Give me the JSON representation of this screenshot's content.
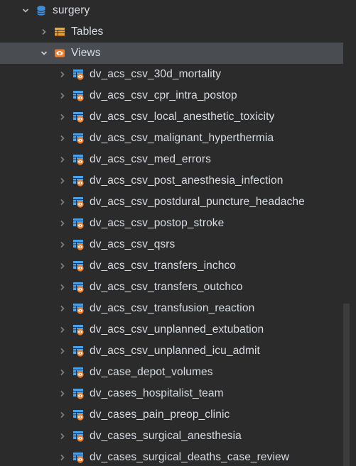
{
  "tree": {
    "database": {
      "label": "surgery",
      "icon": "database-icon",
      "expanded": true
    },
    "tables": {
      "label": "Tables",
      "icon": "table-icon",
      "expanded": false
    },
    "views": {
      "label": "Views",
      "icon": "views-folder-icon",
      "expanded": true
    },
    "view_items": [
      "dv_acs_csv_30d_mortality",
      "dv_acs_csv_cpr_intra_postop",
      "dv_acs_csv_local_anesthetic_toxicity",
      "dv_acs_csv_malignant_hyperthermia",
      "dv_acs_csv_med_errors",
      "dv_acs_csv_post_anesthesia_infection",
      "dv_acs_csv_postdural_puncture_headache",
      "dv_acs_csv_postop_stroke",
      "dv_acs_csv_qsrs",
      "dv_acs_csv_transfers_inchco",
      "dv_acs_csv_transfers_outchco",
      "dv_acs_csv_transfusion_reaction",
      "dv_acs_csv_unplanned_extubation",
      "dv_acs_csv_unplanned_icu_admit",
      "dv_case_depot_volumes",
      "dv_cases_hospitalist_team",
      "dv_cases_pain_preop_clinic",
      "dv_cases_surgical_anesthesia",
      "dv_cases_surgical_deaths_case_review"
    ]
  },
  "colors": {
    "background": "#2b2b2b",
    "selected_row": "#494d51",
    "text": "#d8dde3",
    "database_icon": "#3e8fd8",
    "table_icon": "#f0a92e",
    "views_icon": "#f07d2a",
    "view_item_icon_grid": "#4aa3e8",
    "view_item_icon_eye": "#f07d2a"
  }
}
